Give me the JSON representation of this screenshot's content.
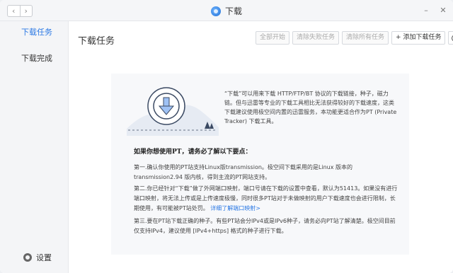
{
  "titlebar": {
    "back": "‹",
    "forward": "›",
    "title": "下载",
    "minimize": "–",
    "close": "✕"
  },
  "sidebar": {
    "items": [
      {
        "label": "下载任务"
      },
      {
        "label": "下载完成"
      }
    ],
    "settings_label": "设置"
  },
  "main": {
    "title": "下载任务",
    "toolbar": {
      "start_all": "全部开始",
      "clear_failed": "清除失败任务",
      "clear_all": "清除所有任务",
      "add_task": "+ 添加下载任务",
      "schedule_caret": "▾"
    },
    "card": {
      "intro": "“下载”可以用来下载 HTTP/FTP/BT 协议的下载链接，种子，磁力链。但与迅雷等专业的下载工具相比无法获得较好的下载速度，这类下载建议使用极空间内置的迅雷服务，本功能更适合作为PT (Private Tracker) 下载工具。",
      "heading": "如果你想使用PT，请务必了解以下要点：",
      "p1": "第一.确认你使用的PT站支持Linux版transmission。极空间下载采用的是Linux 版本的 transmission2.94 版内核，得到主流的PT网站支持。",
      "p2": "第二.你已经针对“下载”做了外网端口映射，端口号请在下载的设置中查看，默认为51413。如果没有进行端口映射，将无法上传或是上传速度极慢，同时很多PT站对于未做映射的用户下载速度也会进行限制，长期使用，有可能被PT站处罚。",
      "p2_link": "详细了解端口映射>",
      "p3": "第三.要在PT站下载正确的种子。有些PT站会分IPv4或是IPv6种子，请务必向PT站了解清楚。极空间目前仅支持IPv4，建议使用 [IPv4+https] 格式的种子进行下载。"
    }
  },
  "colors": {
    "accent": "#2a78e4",
    "sidebar_bg": "#f4f5f7",
    "card_bg": "#f7f8fa"
  }
}
